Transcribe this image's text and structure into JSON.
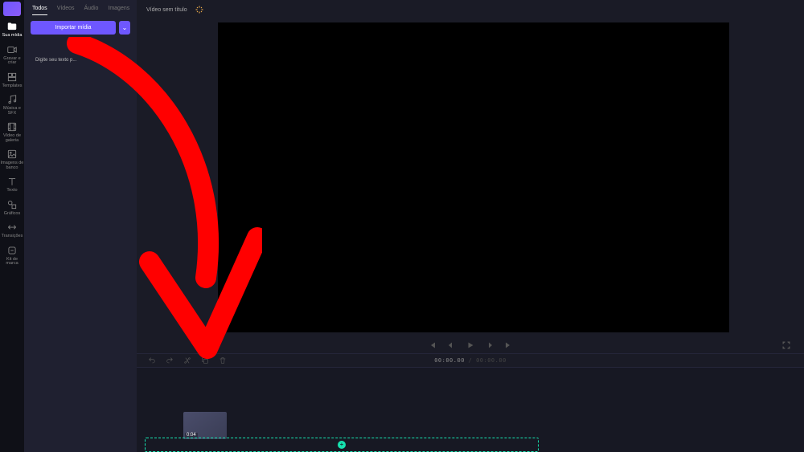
{
  "rail": {
    "items": [
      {
        "label": "Sua mídia"
      },
      {
        "label": "Gravar e criar"
      },
      {
        "label": "Templates"
      },
      {
        "label": "Música e SFX"
      },
      {
        "label": "Vídeo de galeria"
      },
      {
        "label": "Imagens de banco"
      },
      {
        "label": "Texto"
      },
      {
        "label": "Gráficos"
      },
      {
        "label": "Transições"
      },
      {
        "label": "Kit de marca"
      }
    ]
  },
  "panel": {
    "tabs": {
      "todos": "Todos",
      "videos": "Vídeos",
      "audio": "Áudio",
      "imagens": "Imagens"
    },
    "import_label": "Importar mídia",
    "text_media_label": "Digite seu texto p..."
  },
  "topbar": {
    "title": "Vídeo sem título"
  },
  "toolbar": {
    "current": "00:00.00",
    "total": "00:00.00",
    "sep": " / "
  },
  "timeline": {
    "clip_duration": "0:04",
    "drop_plus": "+"
  }
}
